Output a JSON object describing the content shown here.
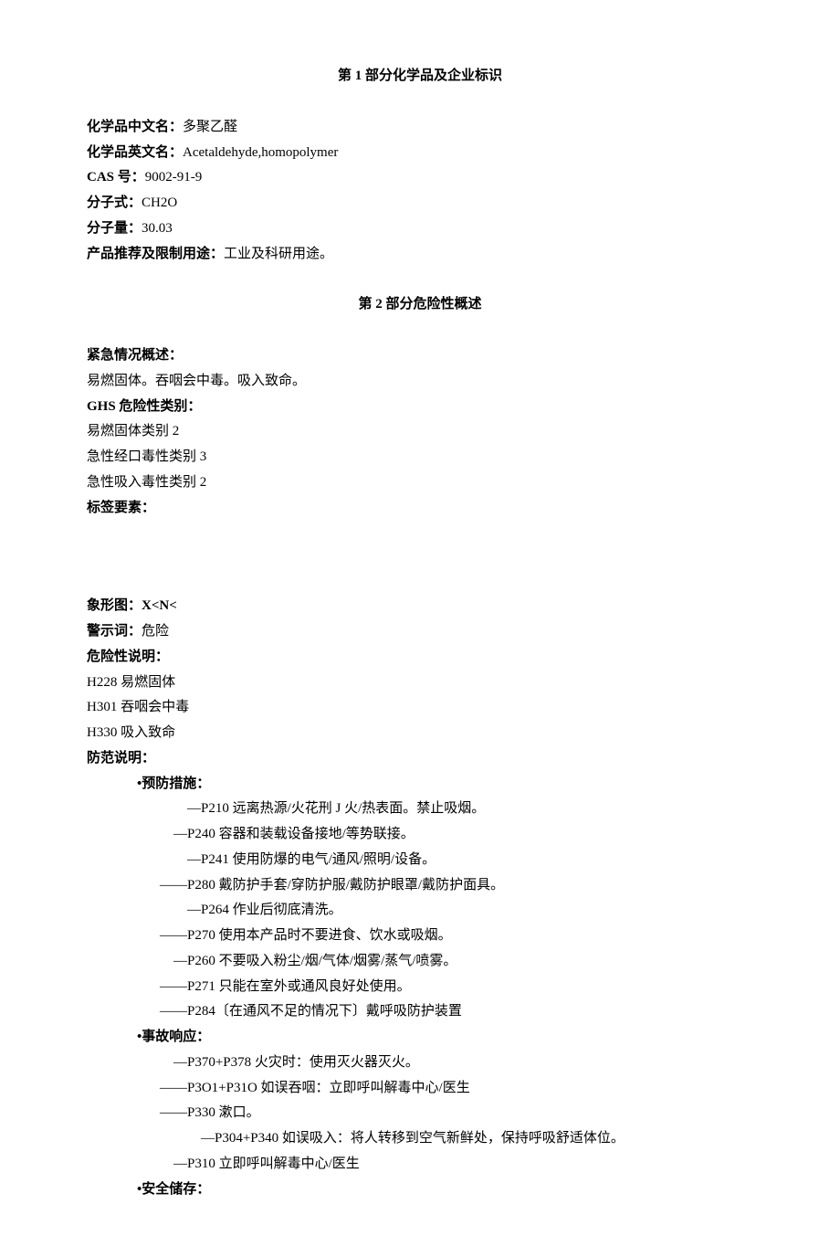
{
  "section1": {
    "title": "第 1 部分化学品及企业标识",
    "fields": {
      "name_cn_label": "化学品中文名：",
      "name_cn_value": "多聚乙醛",
      "name_en_label": "化学品英文名：",
      "name_en_value": "Acetaldehyde,homopolymer",
      "cas_label": "CAS 号：",
      "cas_value": "9002-91-9",
      "formula_label": "分子式：",
      "formula_value": "CH2O",
      "mw_label": "分子量：",
      "mw_value": "30.03",
      "use_label": "产品推荐及限制用途：",
      "use_value": "工业及科研用途。"
    }
  },
  "section2": {
    "title": "第 2 部分危险性概述",
    "emergency_label": "紧急情况概述：",
    "emergency_text": "易燃固体。吞咽会中毒。吸入致命。",
    "ghs_label": "GHS 危险性类别：",
    "ghs_items": [
      "易燃固体类别 2",
      "急性经口毒性类别 3",
      "急性吸入毒性类别 2"
    ],
    "label_elements": "标签要素：",
    "pictogram_label": "象形图：",
    "pictogram_value": "X<N<",
    "signal_label": "警示词：",
    "signal_value": "危险",
    "hazard_label": "危险性说明：",
    "hazard_items": [
      "H228 易燃固体",
      "H301 吞咽会中毒",
      "H330 吸入致命"
    ],
    "precaution_label": "防范说明：",
    "prevention_title": "•预防措施：",
    "prevention_items": [
      {
        "dash": "—",
        "text": "P210 远离热源/火花刑 J 火/热表面。禁止吸烟。",
        "cls": "indent-a"
      },
      {
        "dash": "—",
        "text": "P240 容器和装载设备接地/等势联接。",
        "cls": "indent-b"
      },
      {
        "dash": "—",
        "text": "P241 使用防爆的电气/通风/照明/设备。",
        "cls": "indent-a"
      },
      {
        "dash": "——",
        "text": "P280 戴防护手套/穿防护服/戴防护眼罩/戴防护面具。",
        "cls": "indent-c"
      },
      {
        "dash": "—",
        "text": "P264 作业后彻底清洗。",
        "cls": "indent-a"
      },
      {
        "dash": "——",
        "text": "P270 使用本产品时不要进食、饮水或吸烟。",
        "cls": "indent-c"
      },
      {
        "dash": "—",
        "text": "P260 不要吸入粉尘/烟/气体/烟雾/蒸气/喷雾。",
        "cls": "indent-b"
      },
      {
        "dash": "——",
        "text": "P271 只能在室外或通风良好处使用。",
        "cls": "indent-c"
      },
      {
        "dash": "——",
        "text": "P284〔在通风不足的情况下〕戴呼吸防护装置",
        "cls": "indent-c"
      }
    ],
    "response_title": "•事故响应：",
    "response_items": [
      {
        "dash": "—",
        "text": "P370+P378 火灾时：使用灭火器灭火。",
        "cls": "indent-b"
      },
      {
        "dash": "——",
        "text": "P3O1+P31O 如误吞咽：立即呼叫解毒中心/医生",
        "cls": "indent-c"
      },
      {
        "dash": "——",
        "text": "P330 漱口。",
        "cls": "indent-c"
      },
      {
        "dash": "—",
        "text": "P304+P340 如误吸入：将人转移到空气新鲜处，保持呼吸舒适体位。",
        "cls": "indent-d"
      },
      {
        "dash": "—",
        "text": "P310 立即呼叫解毒中心/医生",
        "cls": "indent-b"
      }
    ],
    "storage_title": "•安全储存："
  }
}
